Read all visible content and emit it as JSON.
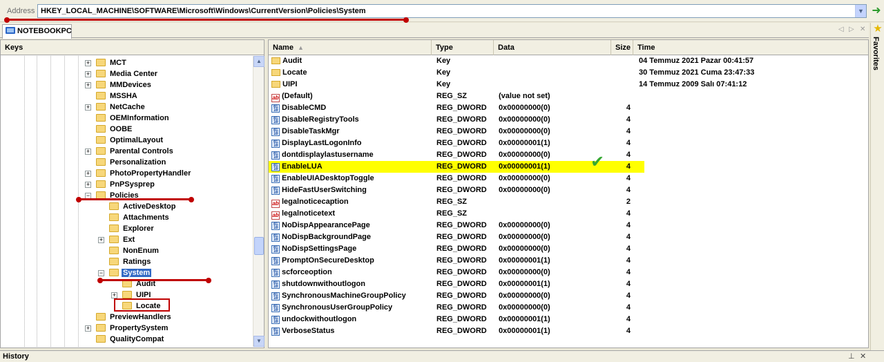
{
  "address": {
    "label": "Address",
    "path": "HKEY_LOCAL_MACHINE\\SOFTWARE\\Microsoft\\Windows\\CurrentVersion\\Policies\\System"
  },
  "tabs": [
    {
      "label": "NOTEBOOKPC"
    }
  ],
  "favorites": {
    "label": "Favorites"
  },
  "keys_panel": {
    "title": "Keys",
    "tree": [
      {
        "label": "MCT",
        "depth": 0,
        "expander": "+"
      },
      {
        "label": "Media Center",
        "depth": 0,
        "expander": "+"
      },
      {
        "label": "MMDevices",
        "depth": 0,
        "expander": "+"
      },
      {
        "label": "MSSHA",
        "depth": 0,
        "expander": ""
      },
      {
        "label": "NetCache",
        "depth": 0,
        "expander": "+"
      },
      {
        "label": "OEMInformation",
        "depth": 0,
        "expander": ""
      },
      {
        "label": "OOBE",
        "depth": 0,
        "expander": ""
      },
      {
        "label": "OptimalLayout",
        "depth": 0,
        "expander": ""
      },
      {
        "label": "Parental Controls",
        "depth": 0,
        "expander": "+"
      },
      {
        "label": "Personalization",
        "depth": 0,
        "expander": ""
      },
      {
        "label": "PhotoPropertyHandler",
        "depth": 0,
        "expander": "+"
      },
      {
        "label": "PnPSysprep",
        "depth": 0,
        "expander": "+"
      },
      {
        "label": "Policies",
        "depth": 0,
        "expander": "-"
      },
      {
        "label": "ActiveDesktop",
        "depth": 1,
        "expander": ""
      },
      {
        "label": "Attachments",
        "depth": 1,
        "expander": ""
      },
      {
        "label": "Explorer",
        "depth": 1,
        "expander": ""
      },
      {
        "label": "Ext",
        "depth": 1,
        "expander": "+"
      },
      {
        "label": "NonEnum",
        "depth": 1,
        "expander": ""
      },
      {
        "label": "Ratings",
        "depth": 1,
        "expander": ""
      },
      {
        "label": "System",
        "depth": 1,
        "expander": "-",
        "selected": true
      },
      {
        "label": "Audit",
        "depth": 2,
        "expander": ""
      },
      {
        "label": "UIPI",
        "depth": 2,
        "expander": "+"
      },
      {
        "label": "Locate",
        "depth": 2,
        "expander": ""
      },
      {
        "label": "PreviewHandlers",
        "depth": 0,
        "expander": ""
      },
      {
        "label": "PropertySystem",
        "depth": 0,
        "expander": "+"
      },
      {
        "label": "QualityCompat",
        "depth": 0,
        "expander": ""
      }
    ]
  },
  "values_panel": {
    "columns": {
      "name": "Name",
      "type": "Type",
      "data": "Data",
      "size": "Size",
      "time": "Time"
    },
    "rows": [
      {
        "name": "Audit",
        "type": "Key",
        "data": "",
        "size": "",
        "time": "04 Temmuz 2021 Pazar 00:41:57",
        "icon": "key"
      },
      {
        "name": "Locate",
        "type": "Key",
        "data": "",
        "size": "",
        "time": "30 Temmuz 2021 Cuma 23:47:33",
        "icon": "key"
      },
      {
        "name": "UIPI",
        "type": "Key",
        "data": "",
        "size": "",
        "time": "14 Temmuz 2009 Salı 07:41:12",
        "icon": "key"
      },
      {
        "name": "(Default)",
        "type": "REG_SZ",
        "data": "(value not set)",
        "size": "",
        "time": "",
        "icon": "sz"
      },
      {
        "name": "DisableCMD",
        "type": "REG_DWORD",
        "data": "0x00000000(0)",
        "size": "4",
        "time": "",
        "icon": "dw"
      },
      {
        "name": "DisableRegistryTools",
        "type": "REG_DWORD",
        "data": "0x00000000(0)",
        "size": "4",
        "time": "",
        "icon": "dw"
      },
      {
        "name": "DisableTaskMgr",
        "type": "REG_DWORD",
        "data": "0x00000000(0)",
        "size": "4",
        "time": "",
        "icon": "dw"
      },
      {
        "name": "DisplayLastLogonInfo",
        "type": "REG_DWORD",
        "data": "0x00000001(1)",
        "size": "4",
        "time": "",
        "icon": "dw"
      },
      {
        "name": "dontdisplaylastusername",
        "type": "REG_DWORD",
        "data": "0x00000000(0)",
        "size": "4",
        "time": "",
        "icon": "dw"
      },
      {
        "name": "EnableLUA",
        "type": "REG_DWORD",
        "data": "0x00000001(1)",
        "size": "4",
        "time": "",
        "icon": "dw",
        "highlight": true
      },
      {
        "name": "EnableUIADesktopToggle",
        "type": "REG_DWORD",
        "data": "0x00000000(0)",
        "size": "4",
        "time": "",
        "icon": "dw"
      },
      {
        "name": "HideFastUserSwitching",
        "type": "REG_DWORD",
        "data": "0x00000000(0)",
        "size": "4",
        "time": "",
        "icon": "dw"
      },
      {
        "name": "legalnoticecaption",
        "type": "REG_SZ",
        "data": "",
        "size": "2",
        "time": "",
        "icon": "sz"
      },
      {
        "name": "legalnoticetext",
        "type": "REG_SZ",
        "data": "",
        "size": "4",
        "time": "",
        "icon": "sz"
      },
      {
        "name": "NoDispAppearancePage",
        "type": "REG_DWORD",
        "data": "0x00000000(0)",
        "size": "4",
        "time": "",
        "icon": "dw"
      },
      {
        "name": "NoDispBackgroundPage",
        "type": "REG_DWORD",
        "data": "0x00000000(0)",
        "size": "4",
        "time": "",
        "icon": "dw"
      },
      {
        "name": "NoDispSettingsPage",
        "type": "REG_DWORD",
        "data": "0x00000000(0)",
        "size": "4",
        "time": "",
        "icon": "dw"
      },
      {
        "name": "PromptOnSecureDesktop",
        "type": "REG_DWORD",
        "data": "0x00000001(1)",
        "size": "4",
        "time": "",
        "icon": "dw"
      },
      {
        "name": "scforceoption",
        "type": "REG_DWORD",
        "data": "0x00000000(0)",
        "size": "4",
        "time": "",
        "icon": "dw"
      },
      {
        "name": "shutdownwithoutlogon",
        "type": "REG_DWORD",
        "data": "0x00000001(1)",
        "size": "4",
        "time": "",
        "icon": "dw"
      },
      {
        "name": "SynchronousMachineGroupPolicy",
        "type": "REG_DWORD",
        "data": "0x00000000(0)",
        "size": "4",
        "time": "",
        "icon": "dw"
      },
      {
        "name": "SynchronousUserGroupPolicy",
        "type": "REG_DWORD",
        "data": "0x00000000(0)",
        "size": "4",
        "time": "",
        "icon": "dw"
      },
      {
        "name": "undockwithoutlogon",
        "type": "REG_DWORD",
        "data": "0x00000001(1)",
        "size": "4",
        "time": "",
        "icon": "dw"
      },
      {
        "name": "VerboseStatus",
        "type": "REG_DWORD",
        "data": "0x00000001(1)",
        "size": "4",
        "time": "",
        "icon": "dw"
      }
    ]
  },
  "history": {
    "label": "History"
  },
  "colors": {
    "highlight": "#ffff00",
    "selection": "#316ac5",
    "annotation": "#c00000",
    "check": "#36a832"
  }
}
